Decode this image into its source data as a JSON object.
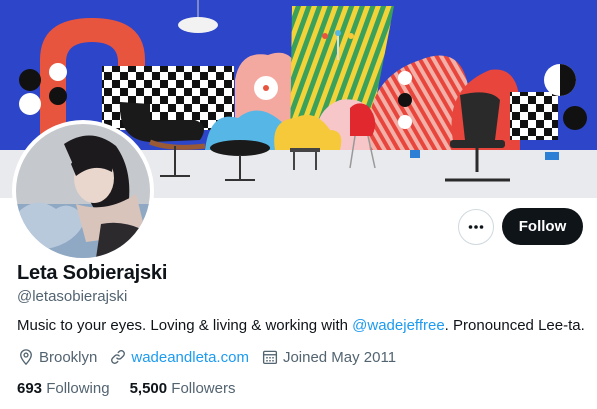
{
  "profile": {
    "name": "Leta Sobierajski",
    "handle": "@letasobierajski",
    "bio": {
      "before": "Music to your eyes. Loving & living & working with ",
      "mention": "@wadejeffree",
      "after": ". Pronounced Lee-ta."
    },
    "location": "Brooklyn",
    "website": "wadeandleta.com",
    "joined": "Joined May 2011"
  },
  "actions": {
    "follow_label": "Follow"
  },
  "stats": {
    "following_count": "693",
    "following_label": "Following",
    "followers_count": "5,500",
    "followers_label": "Followers"
  },
  "icons": {
    "more": "more-horizontal-icon",
    "location": "location-pin-icon",
    "website": "link-icon",
    "joined": "calendar-icon"
  },
  "colors": {
    "accent": "#1d9bf0",
    "text_primary": "#0f1419",
    "text_secondary": "#536471",
    "follow_button_bg": "#0f1419",
    "banner_blue": "#2d45c8"
  }
}
